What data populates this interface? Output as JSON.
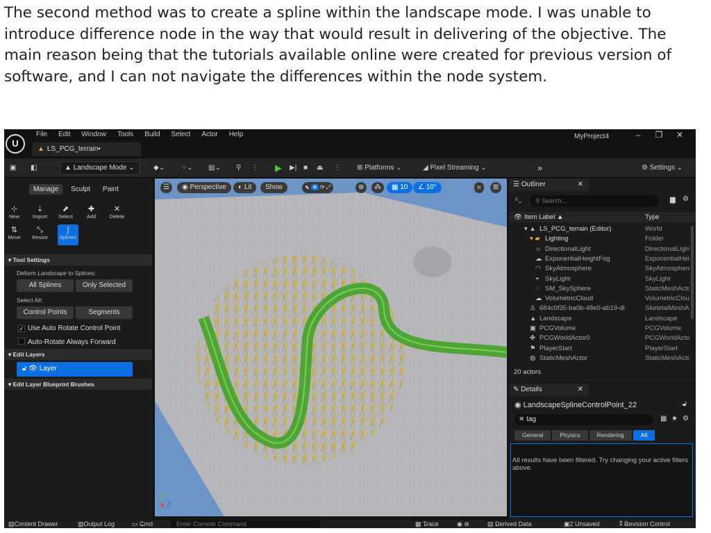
{
  "paragraph": "The second method was to create a spline within the landscape mode. I was unable to introduce difference node in the way that would result in delivering of the objective. The main reason being that the tutorials available online were created for previous version of software, and I can not navigate the differences within the node system.",
  "editor": {
    "logo": "U",
    "menu": [
      "File",
      "Edit",
      "Window",
      "Tools",
      "Build",
      "Select",
      "Actor",
      "Help"
    ],
    "doc_tab": "LS_PCG_terrain•",
    "project": "MyProject4",
    "window_controls": [
      "–",
      "❐",
      "✕"
    ]
  },
  "toolbar": {
    "mode": "Landscape Mode",
    "platforms": "Platforms",
    "pixel_streaming": "Pixel Streaming",
    "more": "»",
    "settings": "Settings"
  },
  "left_panel": {
    "tabs": [
      "Manage",
      "Sculpt",
      "Paint"
    ],
    "tools_row1": [
      "New",
      "Import",
      "Select",
      "Add",
      "Delete"
    ],
    "tools_row2": [
      "Move",
      "Resize",
      "Splines"
    ],
    "tool_settings": "Tool Settings",
    "deform_label": "Deform Landscape to Splines:",
    "all_splines": "All Splines",
    "only_selected": "Only Selected",
    "select_all": "Select All:",
    "control_points": "Control Points",
    "segments": "Segments",
    "auto_rotate": "Use Auto Rotate Control Point",
    "auto_rotate_forward": "Auto-Rotate Always Forward",
    "edit_layers": "Edit Layers",
    "layer": "Layer",
    "blueprint_brushes": "Edit Layer Blueprint Brushes"
  },
  "viewport": {
    "perspective": "Perspective",
    "lit": "Lit",
    "show": "Show",
    "grid_snap": "10",
    "rotation_snap": "10°"
  },
  "outliner": {
    "title": "Outliner",
    "search_placeholder": "Search...",
    "col_label": "Item Label ▲",
    "col_type": "Type",
    "rows": [
      {
        "name": "LS_PCG_terrain (Editor)",
        "type": "World"
      },
      {
        "name": "Lighting",
        "type": "Folder"
      },
      {
        "name": "DirectionalLight",
        "type": "DirectionalLight"
      },
      {
        "name": "ExponentialHeightFog",
        "type": "ExponentialHeightFog"
      },
      {
        "name": "SkyAtmosphere",
        "type": "SkyAtmosphere"
      },
      {
        "name": "SkyLight",
        "type": "SkyLight"
      },
      {
        "name": "SM_SkySphere",
        "type": "StaticMeshActor"
      },
      {
        "name": "VolumetricCloud",
        "type": "VolumetricCloud"
      },
      {
        "name": "684c0f35-ba0b-48e0-ab19-dl",
        "type": "SkeletalMeshActor"
      },
      {
        "name": "Landscape",
        "type": "Landscape"
      },
      {
        "name": "PCGVolume",
        "type": "PCGVolume"
      },
      {
        "name": "PCGWorldActor0",
        "type": "PCGWorldActor"
      },
      {
        "name": "PlayerStart",
        "type": "PlayerStart"
      },
      {
        "name": "StaticMeshActor",
        "type": "StaticMeshActor"
      }
    ],
    "actor_count": "20 actors"
  },
  "details": {
    "title": "Details",
    "object": "LandscapeSplineControlPoint_22",
    "search": "tag",
    "filters": [
      "General",
      "Physics",
      "Rendering",
      "All"
    ],
    "message": "All results have been filtered. Try changing your active filters above."
  },
  "statusbar": {
    "content_drawer": "Content Drawer",
    "output_log": "Output Log",
    "cmd": "Cmd",
    "console_placeholder": "Enter Console Command",
    "trace": "Trace",
    "derived_data": "Derived Data",
    "unsaved": "2 Unsaved",
    "revision_control": "Revision Control"
  },
  "colors": {
    "accent": "#0b70e2",
    "play": "#4fc33d",
    "spline": "#5fb83a",
    "terrain": "#b9b9bd",
    "sky": "#6d94c6"
  }
}
